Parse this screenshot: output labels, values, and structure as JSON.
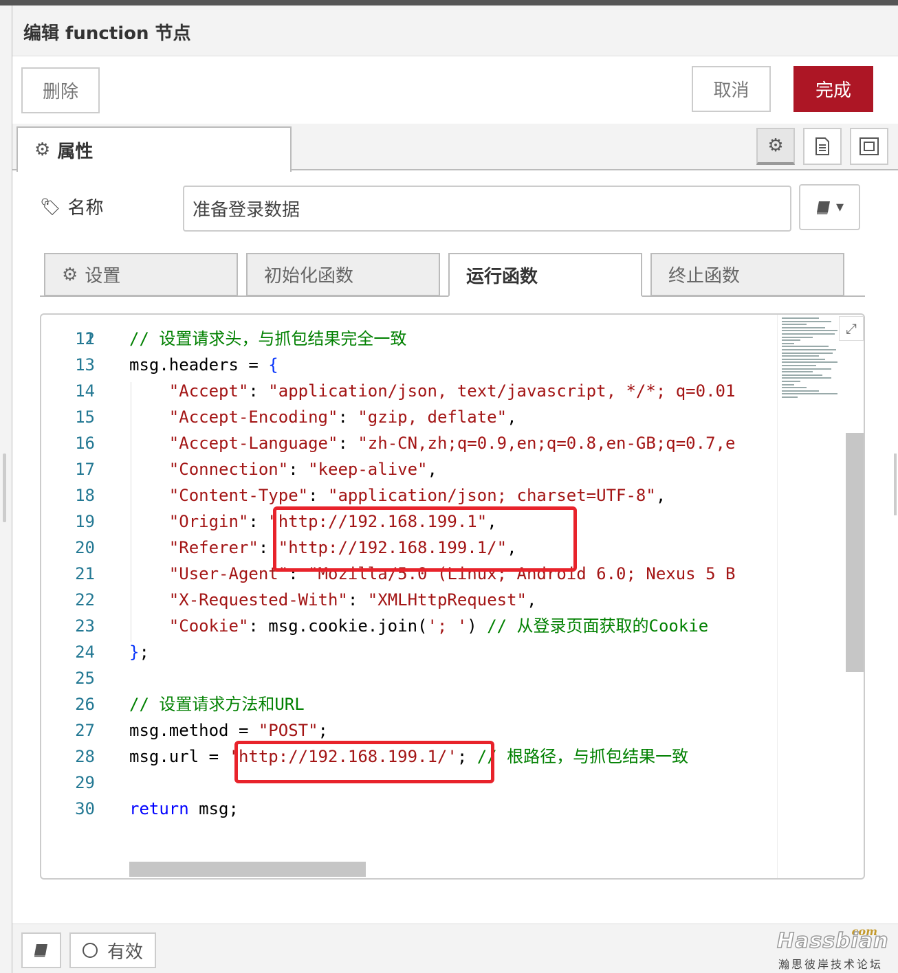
{
  "dialog": {
    "title": "编辑 function 节点",
    "delete_label": "删除",
    "cancel_label": "取消",
    "done_label": "完成"
  },
  "tabs": {
    "properties_label": "属性"
  },
  "name_field": {
    "label": "名称",
    "value": "准备登录数据"
  },
  "subtabs": [
    {
      "label": "设置"
    },
    {
      "label": "初始化函数"
    },
    {
      "label": "运行函数"
    },
    {
      "label": "终止函数"
    }
  ],
  "editor": {
    "partial_line_number": "11",
    "lines": [
      {
        "n": "12",
        "parts": [
          [
            "c-com",
            "// 设置请求头，与抓包结果完全一致"
          ]
        ]
      },
      {
        "n": "13",
        "parts": [
          [
            "",
            "msg.headers = "
          ],
          [
            "c-brace",
            "{"
          ]
        ]
      },
      {
        "n": "14",
        "parts": [
          [
            "",
            "    "
          ],
          [
            "c-str",
            "\"Accept\""
          ],
          [
            "",
            ": "
          ],
          [
            "c-str",
            "\"application/json, text/javascript, */*; q=0.01"
          ]
        ]
      },
      {
        "n": "15",
        "parts": [
          [
            "",
            "    "
          ],
          [
            "c-str",
            "\"Accept-Encoding\""
          ],
          [
            "",
            ": "
          ],
          [
            "c-str",
            "\"gzip, deflate\""
          ],
          [
            "",
            ","
          ]
        ]
      },
      {
        "n": "16",
        "parts": [
          [
            "",
            "    "
          ],
          [
            "c-str",
            "\"Accept-Language\""
          ],
          [
            "",
            ": "
          ],
          [
            "c-str",
            "\"zh-CN,zh;q=0.9,en;q=0.8,en-GB;q=0.7,e"
          ]
        ]
      },
      {
        "n": "17",
        "parts": [
          [
            "",
            "    "
          ],
          [
            "c-str",
            "\"Connection\""
          ],
          [
            "",
            ": "
          ],
          [
            "c-str",
            "\"keep-alive\""
          ],
          [
            "",
            ","
          ]
        ]
      },
      {
        "n": "18",
        "parts": [
          [
            "",
            "    "
          ],
          [
            "c-str",
            "\"Content-Type\""
          ],
          [
            "",
            ": "
          ],
          [
            "c-str",
            "\"application/json; charset=UTF-8\""
          ],
          [
            "",
            ","
          ]
        ]
      },
      {
        "n": "19",
        "parts": [
          [
            "",
            "    "
          ],
          [
            "c-str",
            "\"Origin\""
          ],
          [
            "",
            ": "
          ],
          [
            "c-str",
            "\"http://192.168.199.1\""
          ],
          [
            "",
            ","
          ]
        ]
      },
      {
        "n": "20",
        "parts": [
          [
            "",
            "    "
          ],
          [
            "c-str",
            "\"Referer\""
          ],
          [
            "",
            ": "
          ],
          [
            "c-str",
            "\"http://192.168.199.1/\""
          ],
          [
            "",
            ","
          ]
        ]
      },
      {
        "n": "21",
        "parts": [
          [
            "",
            "    "
          ],
          [
            "c-str",
            "\"User-Agent\""
          ],
          [
            "",
            ": "
          ],
          [
            "c-str",
            "\"Mozilla/5.0 (Linux; Android 6.0; Nexus 5 B"
          ]
        ]
      },
      {
        "n": "22",
        "parts": [
          [
            "",
            "    "
          ],
          [
            "c-str",
            "\"X-Requested-With\""
          ],
          [
            "",
            ": "
          ],
          [
            "c-str",
            "\"XMLHttpRequest\""
          ],
          [
            "",
            ","
          ]
        ]
      },
      {
        "n": "23",
        "parts": [
          [
            "",
            "    "
          ],
          [
            "c-str",
            "\"Cookie\""
          ],
          [
            "",
            ": msg.cookie.join("
          ],
          [
            "c-str",
            "'; '"
          ],
          [
            "",
            ") "
          ],
          [
            "c-com",
            "// 从登录页面获取的Cookie"
          ]
        ]
      },
      {
        "n": "24",
        "parts": [
          [
            "c-brace",
            "}"
          ],
          [
            "",
            ";"
          ]
        ]
      },
      {
        "n": "25",
        "parts": []
      },
      {
        "n": "26",
        "parts": [
          [
            "c-com",
            "// 设置请求方法和URL"
          ]
        ]
      },
      {
        "n": "27",
        "parts": [
          [
            "",
            "msg.method = "
          ],
          [
            "c-str",
            "\"POST\""
          ],
          [
            "",
            ";"
          ]
        ]
      },
      {
        "n": "28",
        "parts": [
          [
            "",
            "msg.url = "
          ],
          [
            "c-str",
            "'http://192.168.199.1/'"
          ],
          [
            "",
            "; "
          ],
          [
            "c-com",
            "// 根路径，与抓包结果一致"
          ]
        ]
      },
      {
        "n": "29",
        "parts": []
      },
      {
        "n": "30",
        "parts": [
          [
            "c-kw",
            "return"
          ],
          [
            "",
            " msg;"
          ]
        ]
      }
    ]
  },
  "footer": {
    "enabled_label": "有效"
  },
  "watermark": {
    "com": "com",
    "brand": "Hassbian",
    "subtitle": "瀚思彼岸技术论坛"
  },
  "icons": {
    "gear": "gear-icon",
    "tag": "tag-icon",
    "book": "book-icon",
    "document": "document-icon",
    "frame": "frame-icon",
    "expand": "expand-icon",
    "circle": "circle-icon"
  },
  "colors": {
    "accent": "#ad1625",
    "highlight": "#e8232b",
    "comment": "#008000",
    "string": "#a31515",
    "keyword": "#0000ff",
    "line_number": "#237893"
  }
}
